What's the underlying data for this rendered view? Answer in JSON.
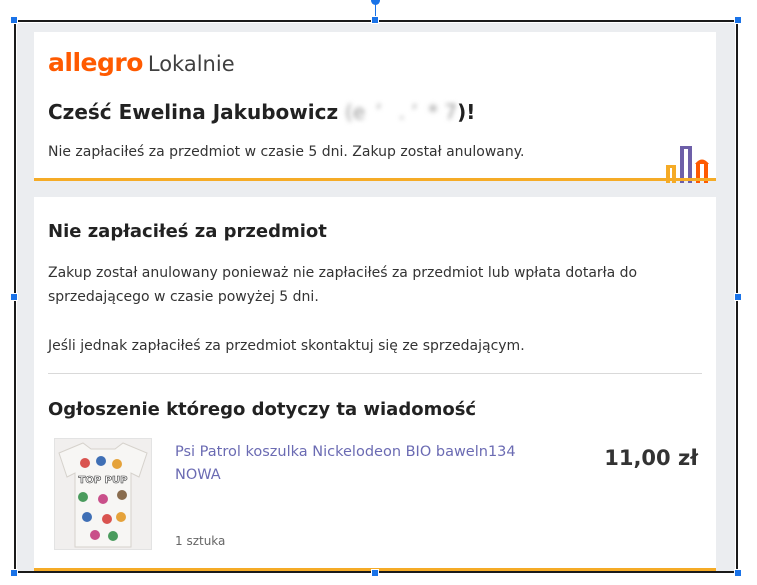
{
  "header": {
    "logo_brand": "allegro",
    "logo_suffix": "Lokalnie",
    "greeting_prefix": "Cześć Ewelina Jakubowicz",
    "greeting_masked": "(e  ’   . ʼ  * 7",
    "greeting_suffix": ")!",
    "intro": "Nie zapłaciłeś za przedmiot w czasie 5 dni. Zakup został anulowany."
  },
  "main": {
    "title": "Nie zapłaciłeś za przedmiot",
    "paragraph1": "Zakup został anulowany ponieważ nie zapłaciłeś za przedmiot lub wpłata dotarła do sprzedającego w czasie powyżej 5 dni.",
    "paragraph2": "Jeśli jednak zapłaciłeś za przedmiot skontaktuj się ze sprzedającym.",
    "listing_heading": "Ogłoszenie którego dotyczy ta wiadomość"
  },
  "item": {
    "title": "Psi Patrol koszulka Nickelodeon BIO baweln134 NOWA",
    "price": "11,00 zł",
    "quantity": "1 sztuka",
    "shirt_print": "TOP PUP"
  },
  "colors": {
    "brand_orange": "#ff5a00",
    "accent_line": "#f5ab26",
    "link": "#6b6bb3",
    "icon_purple": "#6d5fa8",
    "icon_yellow": "#f5ab26",
    "icon_orange": "#ff5a00",
    "selection_handle": "#1a73e8"
  }
}
